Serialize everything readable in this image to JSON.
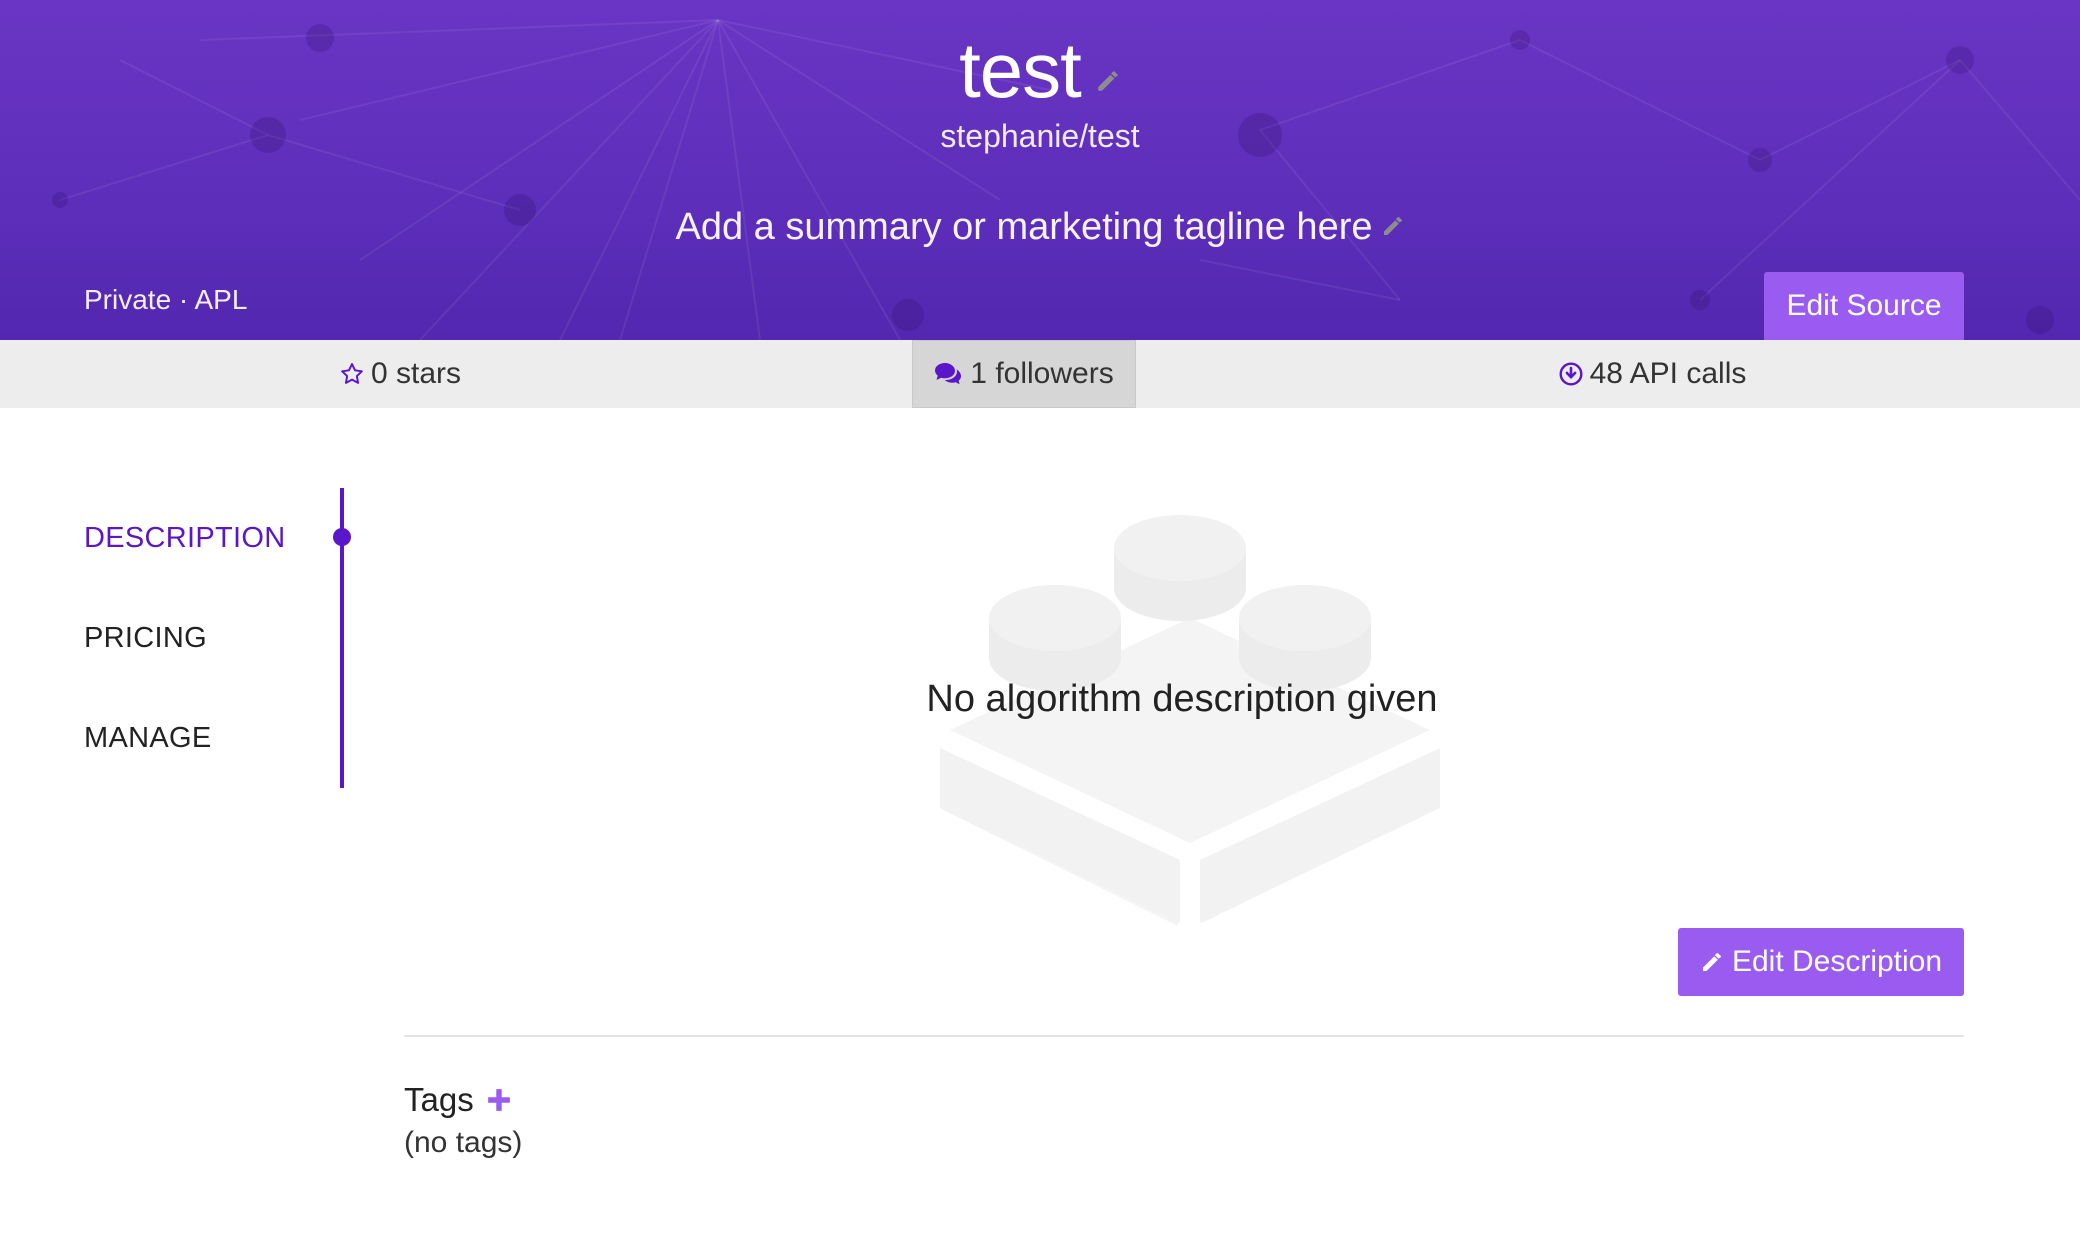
{
  "header": {
    "title": "test",
    "path": "stephanie/test",
    "tagline": "Add a summary or marketing tagline here",
    "visibility": "Private · APL",
    "edit_source_label": "Edit Source"
  },
  "stats": {
    "stars": "0 stars",
    "followers": "1 followers",
    "api_calls": "48 API calls"
  },
  "sidenav": {
    "items": [
      {
        "label": "DESCRIPTION",
        "active": true
      },
      {
        "label": "PRICING",
        "active": false
      },
      {
        "label": "MANAGE",
        "active": false
      }
    ]
  },
  "main": {
    "empty_message": "No algorithm description given",
    "edit_description_label": "Edit Description",
    "tags_heading": "Tags",
    "tags_empty": "(no tags)"
  },
  "icons": {
    "title_edit": "pencil-icon",
    "tagline_edit": "pencil-icon",
    "stars": "star-outline-icon",
    "followers": "comments-icon",
    "api_calls": "download-circle-icon",
    "edit_description": "pencil-icon",
    "tags_add": "plus-icon",
    "placeholder": "lego-brick-icon"
  },
  "colors": {
    "hero_bg": "#5e2fbb",
    "accent": "#5a16c9",
    "button": "#9a5cf0",
    "stats_bg": "#ededed"
  }
}
